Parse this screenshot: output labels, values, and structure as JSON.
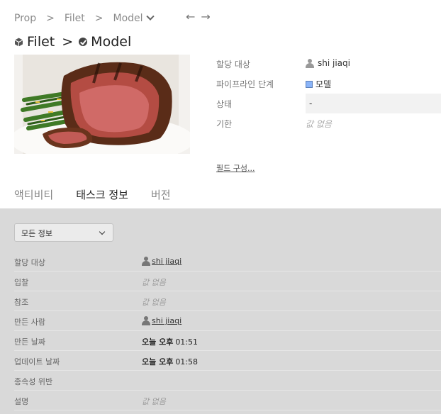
{
  "breadcrumb": {
    "items": [
      "Prop",
      "Filet",
      "Model"
    ],
    "back_icon": "arrow-left-icon",
    "forward_icon": "arrow-right-icon"
  },
  "title": {
    "parent": "Filet",
    "separator": ">",
    "current": "Model"
  },
  "properties": {
    "assignee": {
      "label": "할당 대상",
      "value": "shi jiaqi"
    },
    "pipeline_step": {
      "label": "파이프라인 단계",
      "value": "모델",
      "color": "#8ab4f8"
    },
    "status": {
      "label": "상태",
      "value": "-"
    },
    "due": {
      "label": "기한",
      "value": "값 없음"
    },
    "configure_fields": "필드 구성..."
  },
  "tabs": [
    {
      "label": "액티비티",
      "active": false
    },
    {
      "label": "태스크 정보",
      "active": true
    },
    {
      "label": "버전",
      "active": false
    }
  ],
  "info": {
    "filter": "모든 정보",
    "rows": [
      {
        "label": "할당 대상",
        "value": "shi jiaqi",
        "kind": "user"
      },
      {
        "label": "입찰",
        "value": "값 없음",
        "kind": "empty"
      },
      {
        "label": "참조",
        "value": "값 없음",
        "kind": "empty"
      },
      {
        "label": "만든 사람",
        "value": "shi jiaqi",
        "kind": "user"
      },
      {
        "label": "만든 날짜",
        "value_bold": "오늘 오후",
        "value": "01:51",
        "kind": "date"
      },
      {
        "label": "업데이트 날짜",
        "value_bold": "오늘 오후",
        "value": "01:58",
        "kind": "date"
      },
      {
        "label": "종속성 위반",
        "value": "",
        "kind": "blank"
      },
      {
        "label": "설명",
        "value": "값 없음",
        "kind": "empty"
      }
    ]
  },
  "colors": {
    "panel_bg": "#d9d9d9",
    "accent_stage": "#8ab4f8"
  }
}
